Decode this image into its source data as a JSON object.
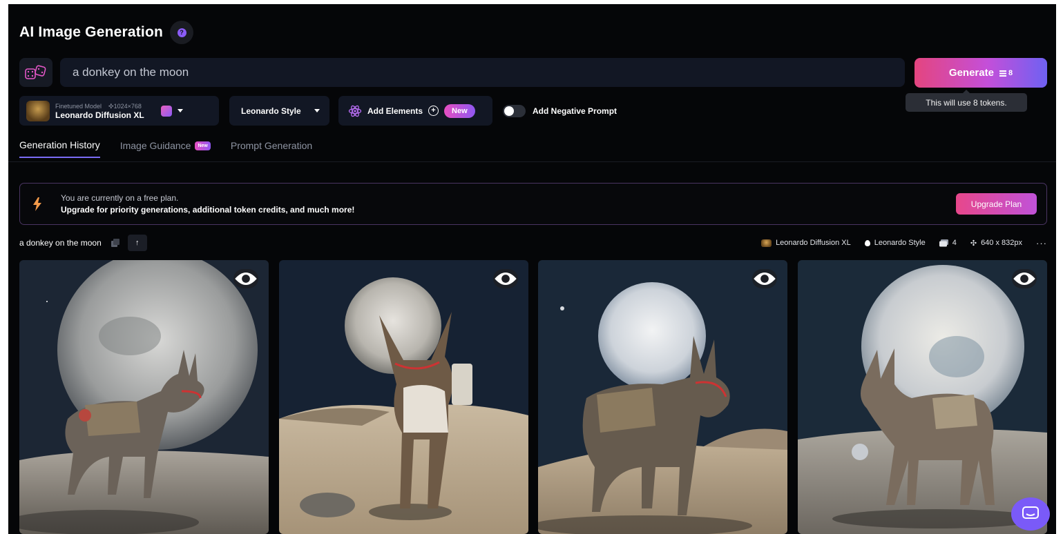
{
  "header": {
    "title": "AI Image Generation",
    "help_icon": "question-icon"
  },
  "prompt": {
    "value": "a donkey on the moon",
    "dice_icon": "dice-icon"
  },
  "generate": {
    "label": "Generate",
    "tokens": "8",
    "tooltip": "This will use 8 tokens."
  },
  "model": {
    "type_label": "Finetuned Model",
    "resolution": "1024×768",
    "name": "Leonardo Diffusion XL"
  },
  "style": {
    "label": "Leonardo Style"
  },
  "elements": {
    "label": "Add Elements",
    "badge": "New"
  },
  "negative_prompt": {
    "label": "Add Negative Prompt",
    "enabled": false
  },
  "tabs": [
    {
      "label": "Generation History",
      "active": true
    },
    {
      "label": "Image Guidance",
      "badge": "New"
    },
    {
      "label": "Prompt Generation"
    }
  ],
  "banner": {
    "line1": "You are currently on a free plan.",
    "line2": "Upgrade for priority generations, additional token credits, and much more!",
    "button": "Upgrade Plan"
  },
  "generation": {
    "prompt": "a donkey on the moon",
    "model": "Leonardo Diffusion XL",
    "style": "Leonardo Style",
    "count": "4",
    "size": "640 x 832px",
    "more": "···"
  },
  "colors": {
    "accent": "#7b6cf6",
    "generate_start": "#e4457f",
    "generate_end": "#6f61f2",
    "background": "#050608"
  }
}
